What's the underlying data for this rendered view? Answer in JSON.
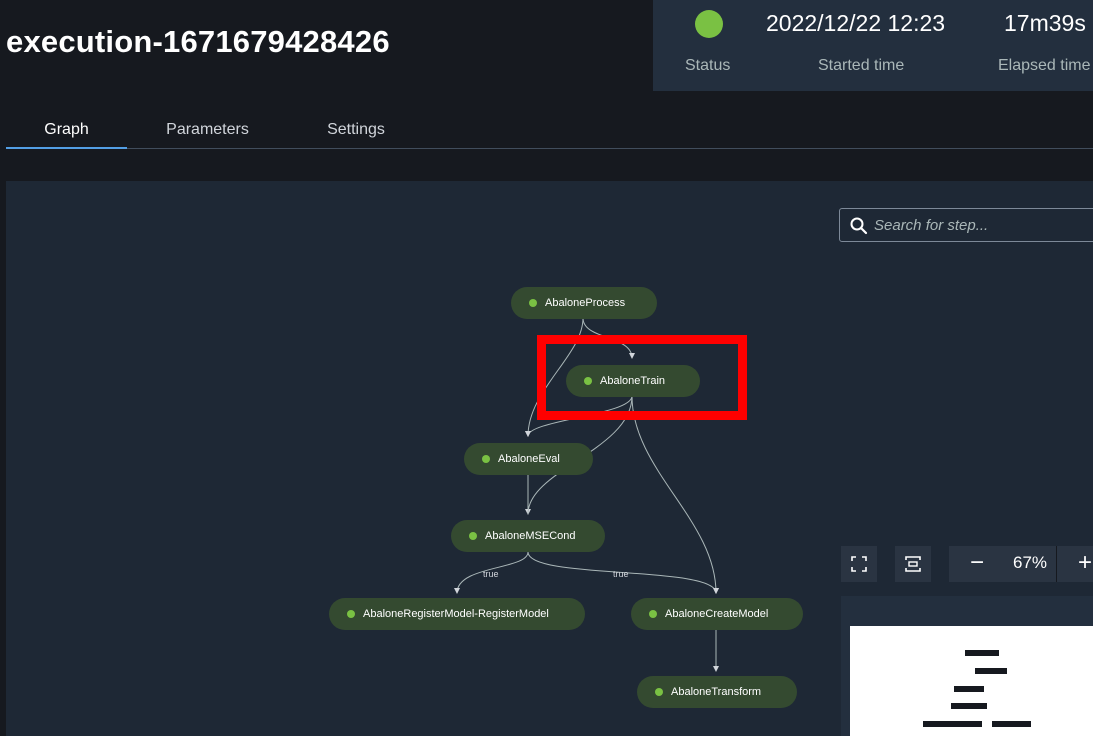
{
  "execution": {
    "title": "execution-1671679428426"
  },
  "summary": {
    "status_color": "#7ac143",
    "status_label": "Status",
    "started_time_value": "2022/12/22 12:23",
    "started_time_label": "Started time",
    "elapsed_time_value": "17m39s",
    "elapsed_time_label": "Elapsed time"
  },
  "tabs": [
    {
      "label": "Graph",
      "active": true
    },
    {
      "label": "Parameters",
      "active": false
    },
    {
      "label": "Settings",
      "active": false
    }
  ],
  "search": {
    "placeholder": "Search for step...",
    "icon": "search-icon"
  },
  "graph": {
    "nodes": [
      {
        "label": "AbaloneProcess",
        "status": "succeeded"
      },
      {
        "label": "AbaloneTrain",
        "status": "succeeded"
      },
      {
        "label": "AbaloneEval",
        "status": "succeeded"
      },
      {
        "label": "AbaloneMSECond",
        "status": "succeeded"
      },
      {
        "label": "AbaloneRegisterModel-RegisterModel",
        "status": "succeeded"
      },
      {
        "label": "AbaloneCreateModel",
        "status": "succeeded"
      },
      {
        "label": "AbaloneTransform",
        "status": "succeeded"
      }
    ],
    "edge_labels": [
      "true",
      "true"
    ],
    "status_dot_color": "#7ac143"
  },
  "controls": {
    "fit_icon": "fit-screen-icon",
    "center_icon": "center-icon",
    "zoom_out_label": "−",
    "zoom_level": "67%",
    "zoom_in_label": "+"
  },
  "colors": {
    "page_bg": "#16191f",
    "canvas_bg": "#1e2835",
    "node_bg": "#344a30",
    "tab_active_underline": "#539fe5",
    "highlight": "#ff0000"
  }
}
